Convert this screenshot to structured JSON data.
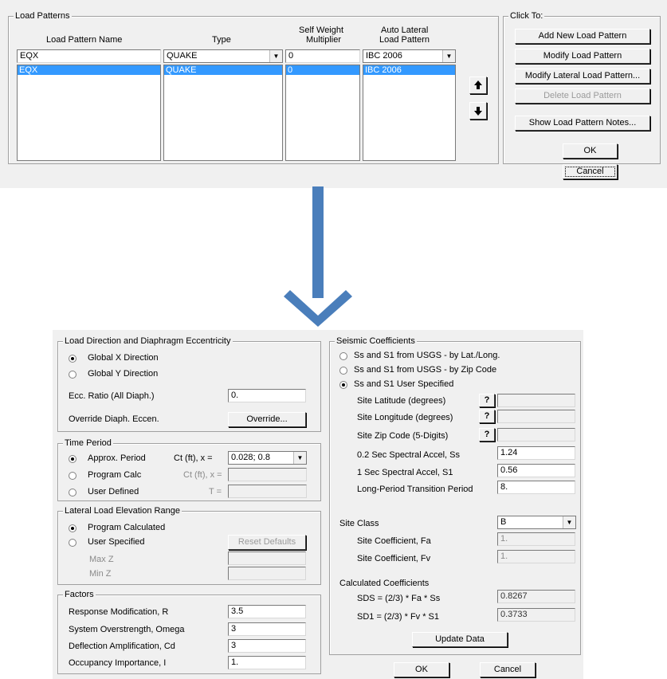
{
  "top_dialog": {
    "group_title": "Load Patterns",
    "headers": {
      "name": "Load Pattern Name",
      "type": "Type",
      "self_weight_1": "Self Weight",
      "self_weight_2": "Multiplier",
      "auto_lateral_1": "Auto Lateral",
      "auto_lateral_2": "Load Pattern"
    },
    "inputs": {
      "name": "EQX",
      "type": "QUAKE",
      "multiplier": "0",
      "auto_lateral": "IBC 2006"
    },
    "rows": [
      {
        "name": "EQX",
        "type": "QUAKE",
        "multiplier": "0",
        "auto_lateral": "IBC 2006"
      }
    ],
    "click_to_title": "Click To:",
    "buttons": {
      "add": "Add New Load Pattern",
      "modify": "Modify Load Pattern",
      "modify_lateral": "Modify Lateral Load Pattern...",
      "delete": "Delete Load Pattern",
      "notes": "Show Load Pattern Notes...",
      "ok": "OK",
      "cancel": "Cancel"
    },
    "arrow_color": "#4a7ebb"
  },
  "bottom_dialog": {
    "load_direction": {
      "title": "Load Direction and Diaphragm Eccentricity",
      "opt_x": "Global  X  Direction",
      "opt_y": "Global  Y  Direction",
      "ecc_label": "Ecc. Ratio (All Diaph.)",
      "ecc_value": "0.",
      "override_label": "Override Diaph. Eccen.",
      "override_button": "Override..."
    },
    "time_period": {
      "title": "Time Period",
      "opt_approx": "Approx. Period",
      "opt_program": "Program Calc",
      "opt_user": "User Defined",
      "ct_label_1": "Ct (ft), x =",
      "ct_value": "0.028;  0.8",
      "ct_label_2": "Ct (ft), x =",
      "t_label": "T ="
    },
    "elevation": {
      "title": "Lateral Load Elevation Range",
      "opt_program": "Program Calculated",
      "opt_user": "User Specified",
      "reset_button": "Reset Defaults",
      "max_label": "Max Z",
      "min_label": "Min Z"
    },
    "factors": {
      "title": "Factors",
      "r_label": "Response Modification, R",
      "r_value": "3.5",
      "omega_label": "System Overstrength, Omega",
      "omega_value": "3",
      "cd_label": "Deflection Amplification, Cd",
      "cd_value": "3",
      "i_label": "Occupancy Importance, I",
      "i_value": "1."
    },
    "seismic": {
      "title": "Seismic Coefficients",
      "opt_latlong": "Ss and S1 from USGS - by Lat./Long.",
      "opt_zip": "Ss and S1 from USGS - by Zip Code",
      "opt_user": "Ss and S1 User Specified",
      "lat_label": "Site Latitude (degrees)",
      "long_label": "Site Longitude (degrees)",
      "zip_label": "Site Zip Code (5-Digits)",
      "help": "?",
      "ss_label": "0.2 Sec Spectral Accel, Ss",
      "ss_value": "1.24",
      "s1_label": "1 Sec Spectral Accel, S1",
      "s1_value": "0.56",
      "tl_label": "Long-Period Transition Period",
      "tl_value": "8.",
      "site_class_label": "Site Class",
      "site_class_value": "B",
      "fa_label": "Site Coefficient, Fa",
      "fa_value": "1.",
      "fv_label": "Site Coefficient, Fv",
      "fv_value": "1.",
      "calc_title": "Calculated Coefficients",
      "sds_label": "SDS = (2/3) * Fa * Ss",
      "sds_value": "0.8267",
      "sd1_label": "SD1 = (2/3) * Fv * S1",
      "sd1_value": "0.3733",
      "update_button": "Update Data"
    },
    "ok": "OK",
    "cancel": "Cancel"
  }
}
